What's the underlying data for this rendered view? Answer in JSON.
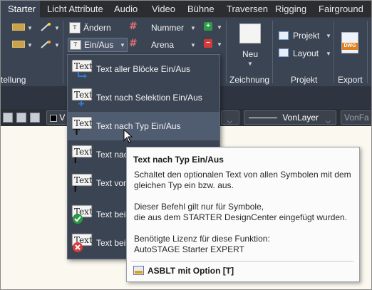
{
  "tabs": [
    {
      "label": "Starter",
      "active": true
    },
    {
      "label": "Licht Attribute"
    },
    {
      "label": "Audio"
    },
    {
      "label": "Video"
    },
    {
      "label": "Bühne"
    },
    {
      "label": "Traversen"
    },
    {
      "label": "Rigging"
    },
    {
      "label": "Fairground"
    }
  ],
  "ribbon": {
    "aendern_label": "Ändern",
    "nummer_label": "Nummer",
    "einaus_label": "Ein/Aus",
    "arena_label": "Arena",
    "neu_label": "Neu",
    "projekt_label": "Projekt",
    "layout_label": "Layout",
    "dwg_label": "DWG",
    "panels": {
      "p1": "tellung",
      "zeichnung": "Zeichnung",
      "projekt": "Projekt",
      "export": "Export"
    }
  },
  "props": {
    "color_prefix": "V",
    "linetype": "VonLayer",
    "lineweight": "VonFa"
  },
  "menu": {
    "items": [
      {
        "label": "Text aller Blöcke Ein/Aus",
        "highlighted": false
      },
      {
        "label": "Text nach Selektion Ein/Aus",
        "highlighted": false
      },
      {
        "label": "Text nach Typ Ein/Aus",
        "highlighted": true
      },
      {
        "label": "Text nach",
        "highlighted": false
      },
      {
        "label": "Text von",
        "highlighted": false
      },
      {
        "label": "Text beim",
        "highlighted": false
      },
      {
        "label": "Text beim",
        "highlighted": false
      }
    ],
    "icon_text": "Text"
  },
  "tooltip": {
    "title": "Text nach Typ Ein/Aus",
    "desc1": "Schaltet den optionalen Text von allen Symbolen mit dem",
    "desc2": "gleichen Typ ein bzw. aus.",
    "note1": "Dieser Befehl gilt nur für Symbole,",
    "note2": "die aus dem STARTER DesignCenter eingefügt wurden.",
    "lic1": "Benötigte Lizenz für diese Funktion:",
    "lic2": "AutoSTAGE Starter EXPERT",
    "command": "ASBLT mit Option [T]"
  },
  "colors": {
    "tabbar": "#2b2d30",
    "ribbon": "#3b4453",
    "menu_highlight": "#505c70",
    "canvas": "#fbf8ef",
    "tooltip_bg": "#fbfbfb"
  }
}
